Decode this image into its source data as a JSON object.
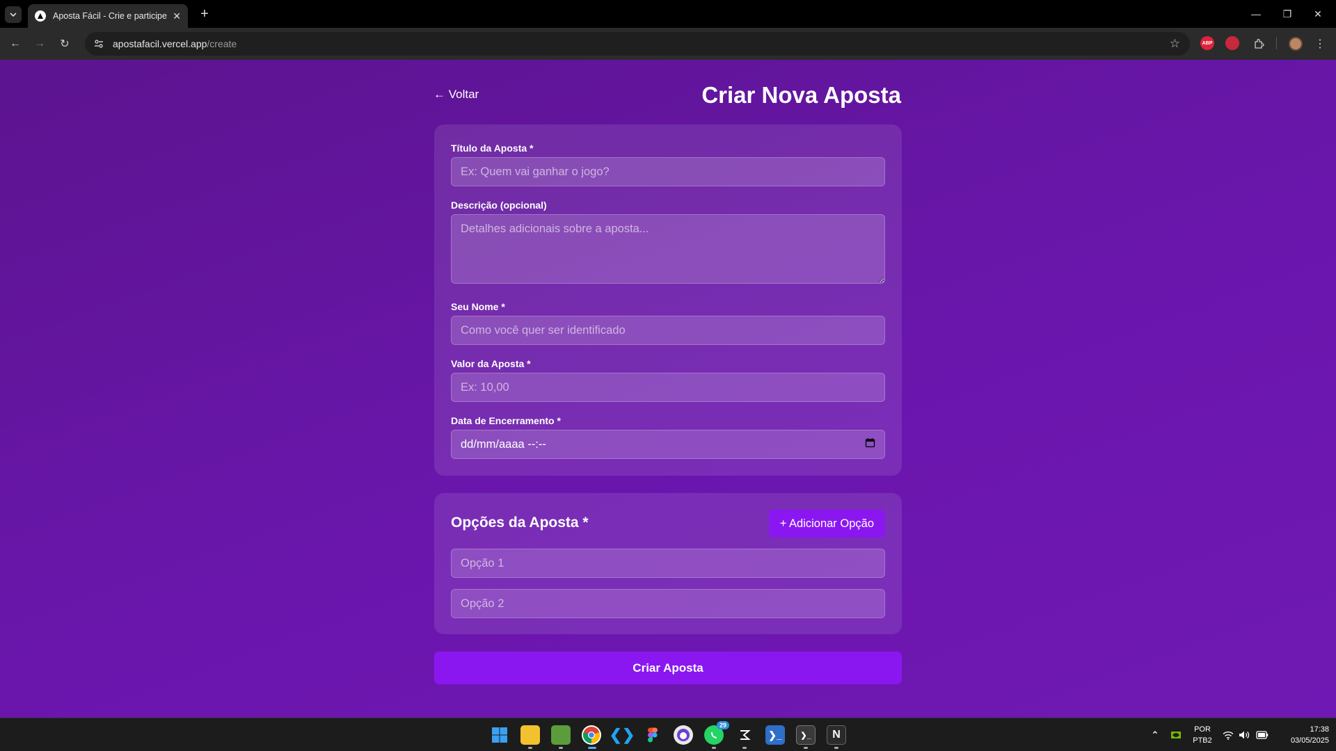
{
  "browser": {
    "tab_title": "Aposta Fácil - Crie e participe d",
    "url_host": "apostafacil.vercel.app",
    "url_path": "/create",
    "extensions": [
      {
        "name": "adblock-plus-icon",
        "label": "ABP",
        "color": "#e0233b"
      },
      {
        "name": "extension-red-icon",
        "label": "",
        "color": "#e0233b"
      }
    ]
  },
  "page": {
    "back_label": "← Voltar",
    "title": "Criar Nova Aposta",
    "form": {
      "title_label": "Título da Aposta *",
      "title_placeholder": "Ex: Quem vai ganhar o jogo?",
      "description_label": "Descrição (opcional)",
      "description_placeholder": "Detalhes adicionais sobre a aposta...",
      "name_label": "Seu Nome *",
      "name_placeholder": "Como você quer ser identificado",
      "value_label": "Valor da Aposta *",
      "value_placeholder": "Ex: 10,00",
      "date_label": "Data de Encerramento *",
      "date_placeholder": "dd/mm/aaaa --:--"
    },
    "options": {
      "title": "Opções da Aposta *",
      "add_label": "+ Adicionar Opção",
      "items": [
        {
          "placeholder": "Opção 1"
        },
        {
          "placeholder": "Opção 2"
        }
      ]
    },
    "submit_label": "Criar Aposta"
  },
  "colors": {
    "accent": "#8b17f0",
    "background": "#6a16ad"
  },
  "taskbar": {
    "whatsapp_badge": "29",
    "language": "POR",
    "keyboard": "PTB2",
    "time": "17:38",
    "date": "03/05/2025"
  }
}
